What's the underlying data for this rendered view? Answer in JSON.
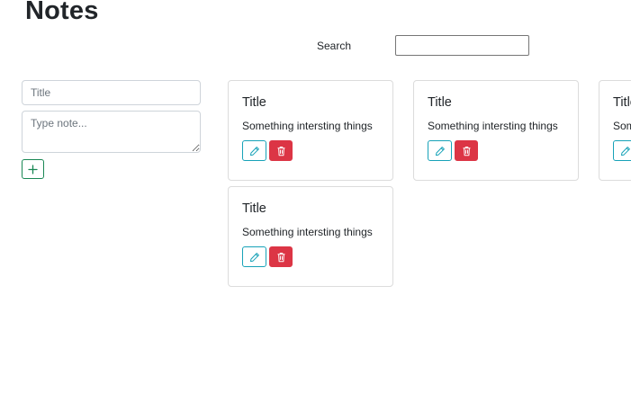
{
  "app": {
    "title": "Notes"
  },
  "search": {
    "label": "Search",
    "value": "",
    "placeholder": ""
  },
  "form": {
    "title_placeholder": "Title",
    "note_placeholder": "Type note..."
  },
  "notes": [
    {
      "title": "Title",
      "body": "Something intersting things"
    },
    {
      "title": "Title",
      "body": "Something intersting things"
    },
    {
      "title": "Title",
      "body": "Something intersting things"
    },
    {
      "title": "Title",
      "body": "Something intersting things"
    }
  ],
  "colors": {
    "add_accent": "#198754",
    "edit_accent": "#17a2b8",
    "delete_accent": "#dc3545"
  },
  "icons": {
    "add": "plus-icon",
    "edit": "pencil-icon",
    "delete": "trash-icon"
  }
}
